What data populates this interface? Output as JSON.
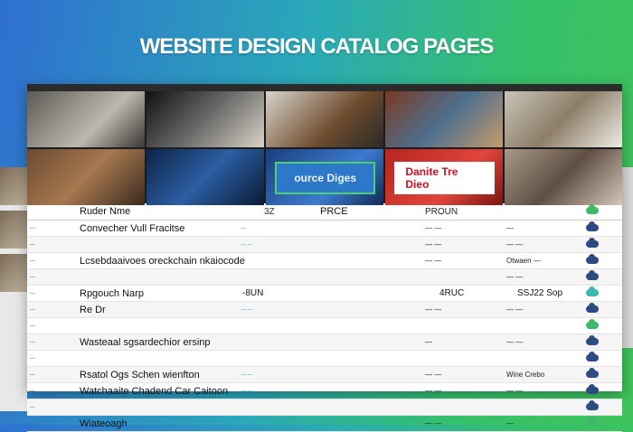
{
  "headline": "WEBSITE DESIGN CATALOG PAGES",
  "colors": {
    "accent_green": "#3fb86a",
    "accent_navy": "#2d4a82",
    "accent_teal": "#3fb7b0",
    "banner_blue": "#2d78c8",
    "banner_red": "#cf2a26"
  },
  "gallery": {
    "banner_left": "ource Diges",
    "banner_right": "Danite Tre Dieo"
  },
  "table": {
    "headers": {
      "name": "Ruder Nme",
      "mid": "3Z",
      "price": "PRCE",
      "product": "PROUN"
    },
    "rows": [
      {
        "idx": "—",
        "name": "Convecher Vull Fracitse",
        "link": "—",
        "price": "",
        "prod": "— —",
        "status": "—",
        "cloud": "navy"
      },
      {
        "idx": "—",
        "name": "",
        "link": "— —",
        "price": "",
        "prod": "— —",
        "status": "— —",
        "cloud": "navy"
      },
      {
        "idx": "—",
        "name": "Lcsebdaaivoes oreckchain nkaiocode",
        "link": "",
        "price": "",
        "prod": "— —",
        "status": "Otwaen —",
        "cloud": "navy"
      },
      {
        "idx": "—",
        "name": "",
        "link": "",
        "price": "",
        "prod": "",
        "status": "— —",
        "cloud": "navy"
      },
      {
        "idx": "—",
        "name": "Rpgouch Narp",
        "link": "",
        "price": "",
        "prod": "",
        "status": "",
        "cloud": "teal",
        "mid": "-8UN",
        "mid2": "4RUC",
        "right": "SSJ22 Sop"
      },
      {
        "idx": "—",
        "name": "Re Dr",
        "link": "— —",
        "price": "",
        "prod": "— —",
        "status": "— —",
        "cloud": "navy"
      },
      {
        "idx": "—",
        "name": "",
        "link": "",
        "price": "",
        "prod": "",
        "status": "",
        "cloud": "green"
      },
      {
        "idx": "—",
        "name": "Wasteaal sgsardechior ersinp",
        "link": "",
        "price": "",
        "prod": "—",
        "status": "— —",
        "cloud": "navy"
      },
      {
        "idx": "—",
        "name": "",
        "link": "",
        "price": "",
        "prod": "",
        "status": "",
        "cloud": "navy"
      },
      {
        "idx": "—",
        "name": "Rsatol Ogs Schen wienfton",
        "link": "— —",
        "price": "",
        "prod": "— —",
        "status": "Wine Crebo",
        "cloud": "navy"
      },
      {
        "idx": "—",
        "name": "Watchaaite Chadend Car Caitoon",
        "link": "— —",
        "price": "",
        "prod": "— —",
        "status": "— —",
        "cloud": "navy"
      },
      {
        "idx": "—",
        "name": "",
        "link": "",
        "price": "",
        "prod": "",
        "status": "",
        "cloud": "navy"
      },
      {
        "idx": "—",
        "name": "Wiateoagh",
        "link": "",
        "price": "",
        "prod": "— —",
        "status": "—",
        "cloud": "green"
      }
    ]
  }
}
